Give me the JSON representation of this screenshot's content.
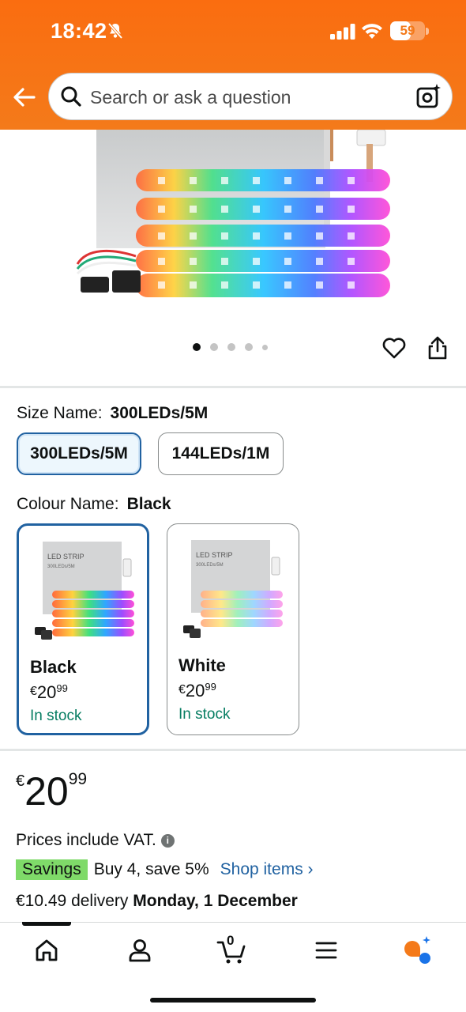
{
  "status_bar": {
    "time": "18:42",
    "battery": "59",
    "battery_level": 0.59
  },
  "header": {
    "search_placeholder": "Search or ask a question",
    "icons": [
      "back-arrow-icon",
      "search-icon",
      "camera-search-icon"
    ]
  },
  "gallery": {
    "image_count": 5,
    "active_index": 0,
    "actions": [
      "heart-icon",
      "share-icon"
    ]
  },
  "size": {
    "label": "Size Name:",
    "selected": "300LEDs/5M",
    "options": [
      {
        "label": "300LEDs/5M",
        "selected": true
      },
      {
        "label": "144LEDs/1M",
        "selected": false
      }
    ]
  },
  "colour": {
    "label": "Colour Name:",
    "selected": "Black",
    "options": [
      {
        "name": "Black",
        "currency": "€",
        "price_whole": "20",
        "price_fraction": "99",
        "stock": "In stock",
        "box_title": "LED STRIP",
        "box_subtitle": "300LEDs/5M",
        "selected": true
      },
      {
        "name": "White",
        "currency": "€",
        "price_whole": "20",
        "price_fraction": "99",
        "stock": "In stock",
        "box_title": "LED STRIP",
        "box_subtitle": "300LEDs/5M",
        "selected": false
      }
    ]
  },
  "price": {
    "currency": "€",
    "whole": "20",
    "fraction": "99",
    "vat_note": "Prices include VAT.",
    "savings_badge": "Savings",
    "savings_text": "Buy 4, save 5%",
    "shop_link": "Shop items ›",
    "delivery_prefix": "€10.49 delivery",
    "delivery_date": "Monday, 1 December"
  },
  "bottom_nav": {
    "cart_count": "0",
    "items": [
      "home-icon",
      "account-icon",
      "cart-icon",
      "menu-icon",
      "rufus-assistant-icon"
    ],
    "active": "home-icon"
  },
  "colors": {
    "header_orange": "#f47a1a",
    "link_blue": "#2162a1",
    "stock_green": "#067d62",
    "savings_green": "#7fda69",
    "selected_border": "#2162a1"
  }
}
